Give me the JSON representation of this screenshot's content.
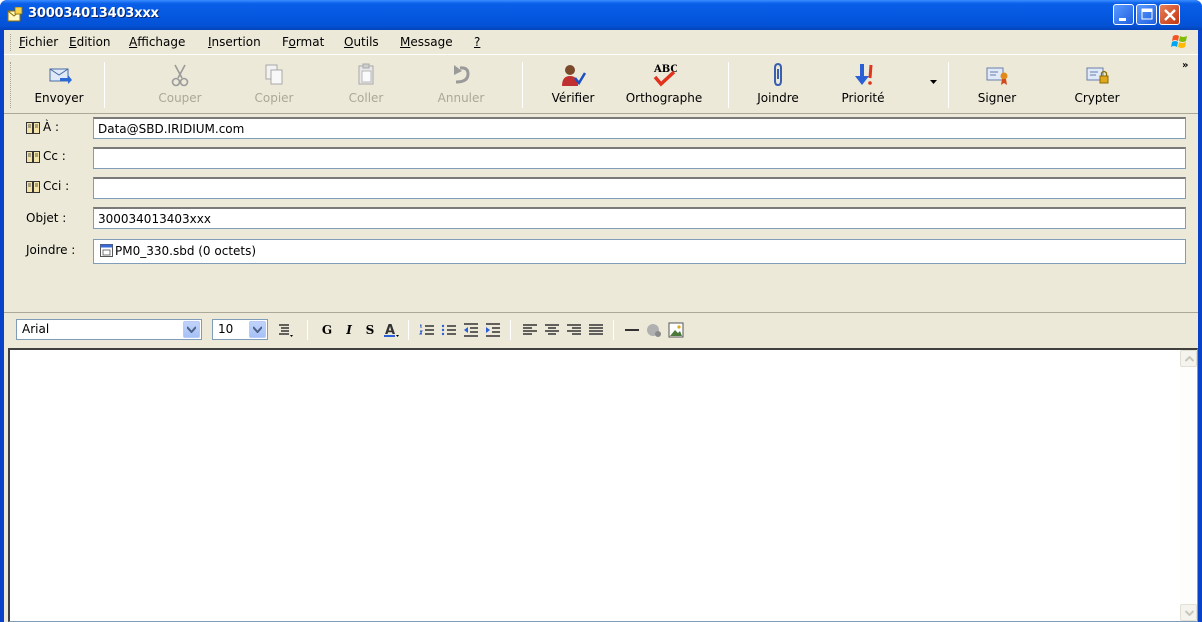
{
  "window": {
    "title": "300034013403xxx"
  },
  "menu": {
    "items": [
      {
        "pre": "",
        "key": "F",
        "post": "ichier"
      },
      {
        "pre": "",
        "key": "E",
        "post": "dition"
      },
      {
        "pre": "",
        "key": "A",
        "post": "ffichage"
      },
      {
        "pre": "",
        "key": "I",
        "post": "nsertion"
      },
      {
        "pre": "F",
        "key": "o",
        "post": "rmat"
      },
      {
        "pre": "",
        "key": "O",
        "post": "utils"
      },
      {
        "pre": "",
        "key": "M",
        "post": "essage"
      },
      {
        "pre": "",
        "key": "?",
        "post": ""
      }
    ]
  },
  "toolbar": {
    "send": "Envoyer",
    "cut": "Couper",
    "copy": "Copier",
    "paste": "Coller",
    "undo": "Annuler",
    "check": "Vérifier",
    "spelling": "Orthographe",
    "attach": "Joindre",
    "priority": "Priorité",
    "sign": "Signer",
    "encrypt": "Crypter",
    "more": "»"
  },
  "headers": {
    "to_label": "À :",
    "to_value": "Data@SBD.IRIDIUM.com",
    "cc_label": "Cc :",
    "cc_value": "",
    "bcc_label": "Cci :",
    "bcc_value": "",
    "subject_label": "Objet :",
    "subject_value": "300034013403xxx",
    "attach_label": "Joindre :",
    "attach_value": "PM0_330.sbd (0 octets)"
  },
  "format": {
    "font": "Arial",
    "size": "10",
    "bold": "G",
    "italic": "I",
    "underline": "S"
  },
  "colors": {
    "title_bar": "#0558e0",
    "chrome": "#ece9d8",
    "close_button": "#c2350f",
    "field_border": "#7f9db9"
  },
  "body": {
    "text": ""
  }
}
